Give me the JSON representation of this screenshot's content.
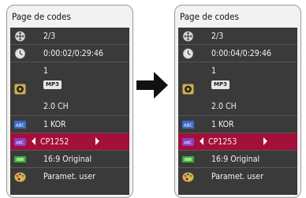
{
  "before": {
    "title": "Page de codes",
    "title_row": "2/3",
    "time": "0:00:02/0:29:46",
    "audio": {
      "track": "1",
      "format": "MP3",
      "channels": "2.0 CH"
    },
    "subtitle": "1 KOR",
    "code_page": "CP1252",
    "aspect": "16:9 Original",
    "picture_mode": "Paramet. user"
  },
  "after": {
    "title": "Page de codes",
    "title_row": "2/3",
    "time": "0:00:04/0:29:46",
    "audio": {
      "track": "1",
      "format": "MP3",
      "channels": "2.0 CH"
    },
    "subtitle": "1 KOR",
    "code_page": "CP1253",
    "aspect": "16:9 Original",
    "picture_mode": "Paramet. user"
  },
  "icons": {
    "title": "film-reel-icon",
    "time": "clock-icon",
    "audio": "speaker-icon",
    "subtitle": "abc-subtitle-icon",
    "code_page": "abc-codepage-icon",
    "aspect": "aspect-ratio-icon",
    "picture": "palette-icon"
  },
  "colors": {
    "highlight": "#a3103a",
    "list_bg": "#3a3a3a",
    "panel_bg": "#f2f2f2"
  }
}
